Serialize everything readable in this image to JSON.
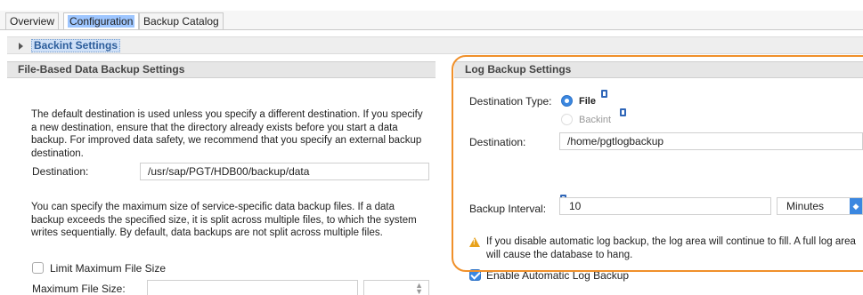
{
  "tabs": [
    {
      "label": "Overview",
      "active": false
    },
    {
      "label": "Configuration",
      "active": true
    },
    {
      "label": "Backup Catalog",
      "active": false
    }
  ],
  "backint": {
    "label": "Backint Settings",
    "expanded": false
  },
  "file_backup": {
    "header": "File-Based Data Backup Settings",
    "intro": "The default destination is used unless you specify a different destination. If you specify a new destination, ensure that the directory already exists before you start a data backup. For improved data safety, we recommend that you specify an external backup destination.",
    "destination_label": "Destination:",
    "destination_value": "/usr/sap/PGT/HDB00/backup/data",
    "size_info": "You can specify the maximum size of service-specific data backup files. If a data backup exceeds the specified size, it is split across multiple files, to which the system writes sequentially. By default, data backups are not split across multiple files.",
    "limit_label": "Limit Maximum File Size",
    "limit_checked": false,
    "max_size_label": "Maximum File Size:",
    "max_size_value": "",
    "max_size_unit": ""
  },
  "log_backup": {
    "header": "Log Backup Settings",
    "dest_type_label": "Destination Type:",
    "option_file": "File",
    "option_backint": "Backint",
    "selected": "File",
    "destination_label": "Destination:",
    "destination_value": "/home/pgtlogbackup",
    "interval_label": "Backup Interval:",
    "interval_value": "10",
    "interval_unit": "Minutes",
    "warning": "If you disable automatic log backup, the log area will continue to fill. A full log area will cause the database to hang.",
    "enable_label": "Enable Automatic Log Backup",
    "enable_checked": true
  },
  "colors": {
    "highlight": "#f0902a",
    "accent": "#3b87e0"
  }
}
